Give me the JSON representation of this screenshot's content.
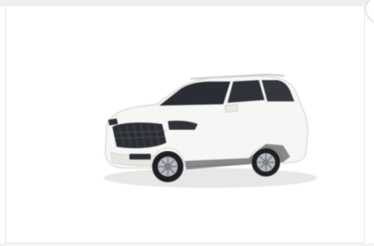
{
  "product_card": {
    "image_alt": "White SUV",
    "body_color": "#f6f6f4",
    "grille_color": "#2b2e33",
    "tire_color": "#1d1f22",
    "badge_text": ""
  }
}
